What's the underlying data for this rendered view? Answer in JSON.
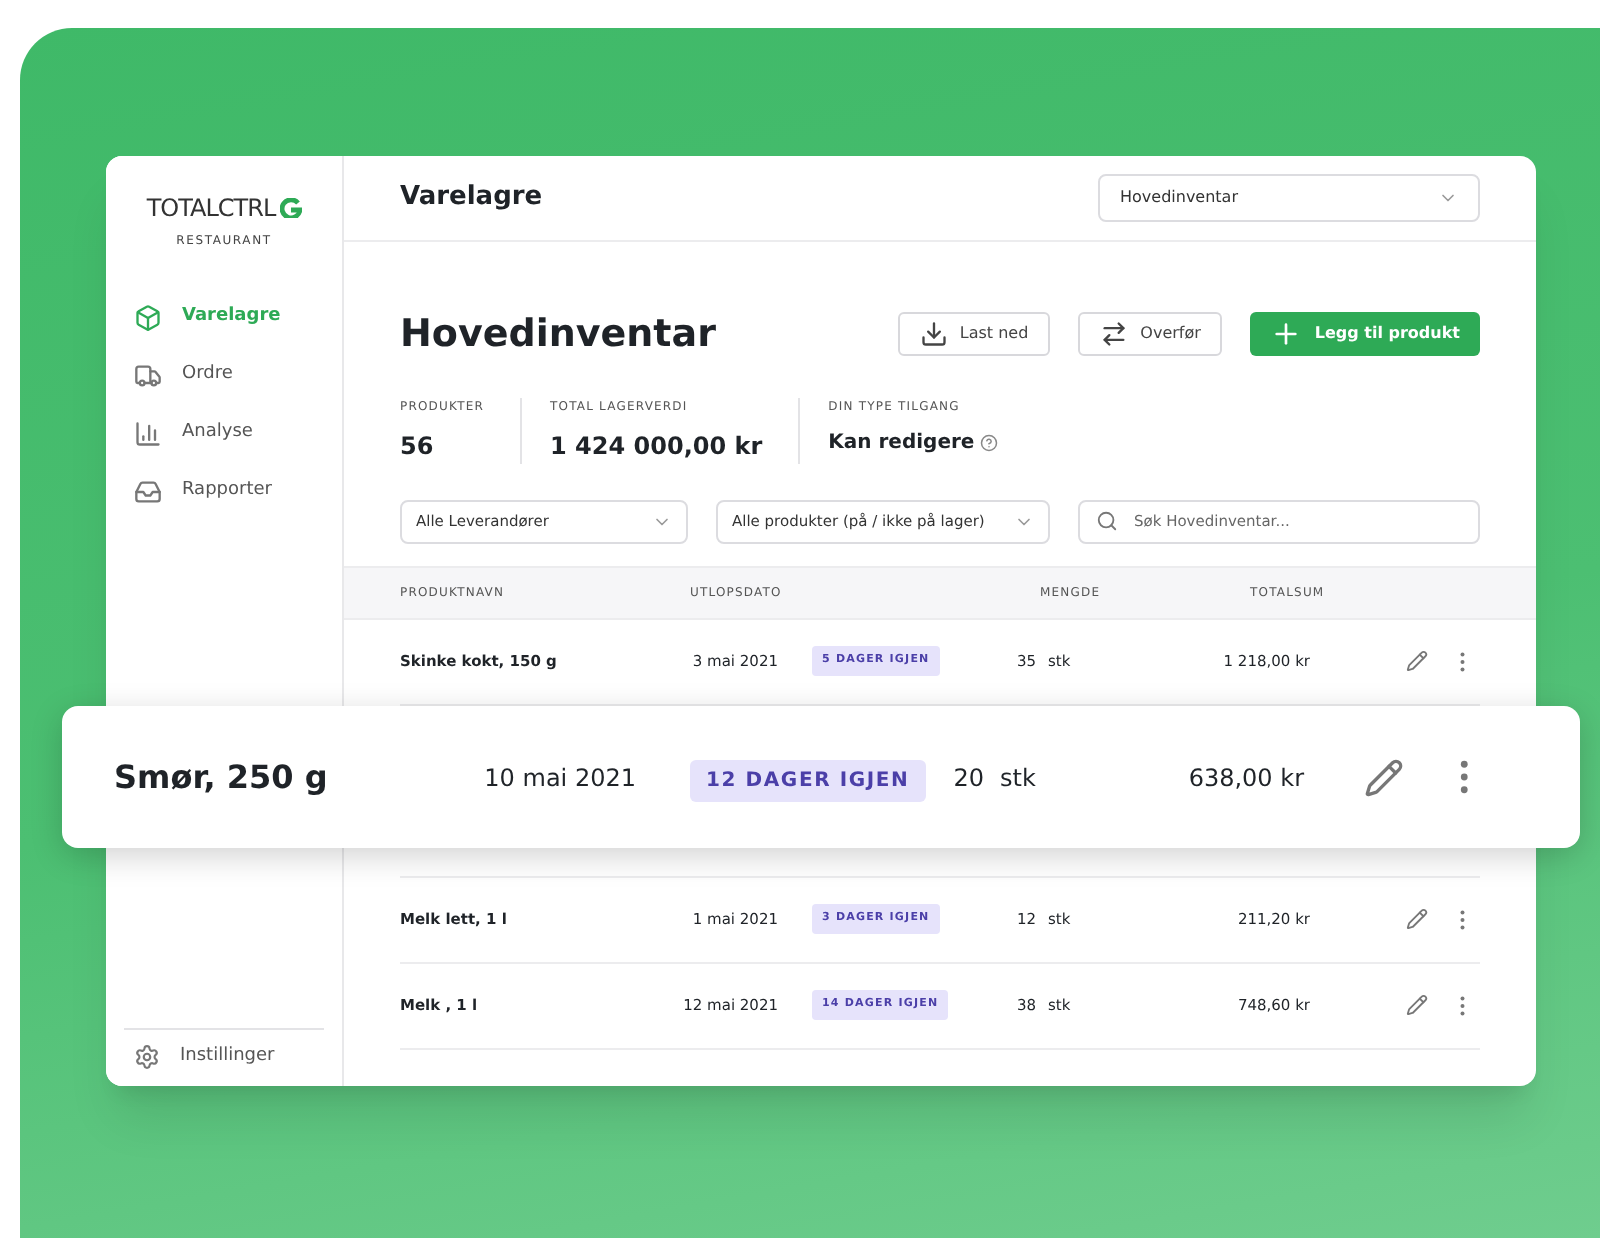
{
  "sidebar": {
    "logo": "TOTALCTRL",
    "logo_subtitle": "RESTAURANT",
    "items": [
      {
        "label": "Varelagre",
        "selected": true
      },
      {
        "label": "Ordre",
        "selected": false
      },
      {
        "label": "Analyse",
        "selected": false
      },
      {
        "label": "Rapporter",
        "selected": false
      }
    ],
    "settings": "Instillinger"
  },
  "header": {
    "title": "Varelagre",
    "select": "Hovedinventar"
  },
  "page": {
    "title": "Hovedinventar",
    "buttons": [
      {
        "label": "Last ned",
        "kind": "download"
      },
      {
        "label": "Overfør",
        "kind": "transfer"
      },
      {
        "label": "Legg til produkt",
        "kind": "add"
      }
    ]
  },
  "stats": [
    {
      "label": "PRODUKTER",
      "value": "56",
      "info": false
    },
    {
      "label": "TOTAL LAGERVERDI",
      "value": "1 424 000,00 kr",
      "info": false
    },
    {
      "label": "DIN TYPE TILGANG",
      "value": "Kan redigere",
      "info": true
    }
  ],
  "filters": [
    {
      "value": "Alle Leverandører"
    },
    {
      "value": "Alle produkter (på / ikke på lager)"
    }
  ],
  "search": {
    "placeholder": "Søk Hovedinventar..."
  },
  "table": {
    "columns": [
      "PRODUKTNAVN",
      "UTLOPSDATO",
      "MENGDE",
      "TOTALSUM"
    ],
    "rows": [
      {
        "name": "Skinke kokt,  150 g",
        "date": "3 mai 2021",
        "badge": "5 DAGER IGJEN",
        "qty": "35",
        "unit": "stk",
        "total": "1 218,00 kr"
      },
      {
        "hidden": true
      },
      {
        "name": "Melk lett, 1 l",
        "date": "1 mai 2021",
        "badge": "3 DAGER IGJEN",
        "qty": "12",
        "unit": "stk",
        "total": "211,20 kr"
      },
      {
        "name": "Melk , 1 l",
        "date": "12 mai 2021",
        "badge": "14 DAGER IGJEN",
        "qty": "38",
        "unit": "stk",
        "total": "748,60 kr"
      }
    ]
  },
  "highlighted_row": {
    "name": "Smør, 250 g",
    "date": "10 mai 2021",
    "badge": "12 DAGER IGJEN",
    "qty": "20",
    "unit": "stk",
    "total": "638,00 kr"
  }
}
